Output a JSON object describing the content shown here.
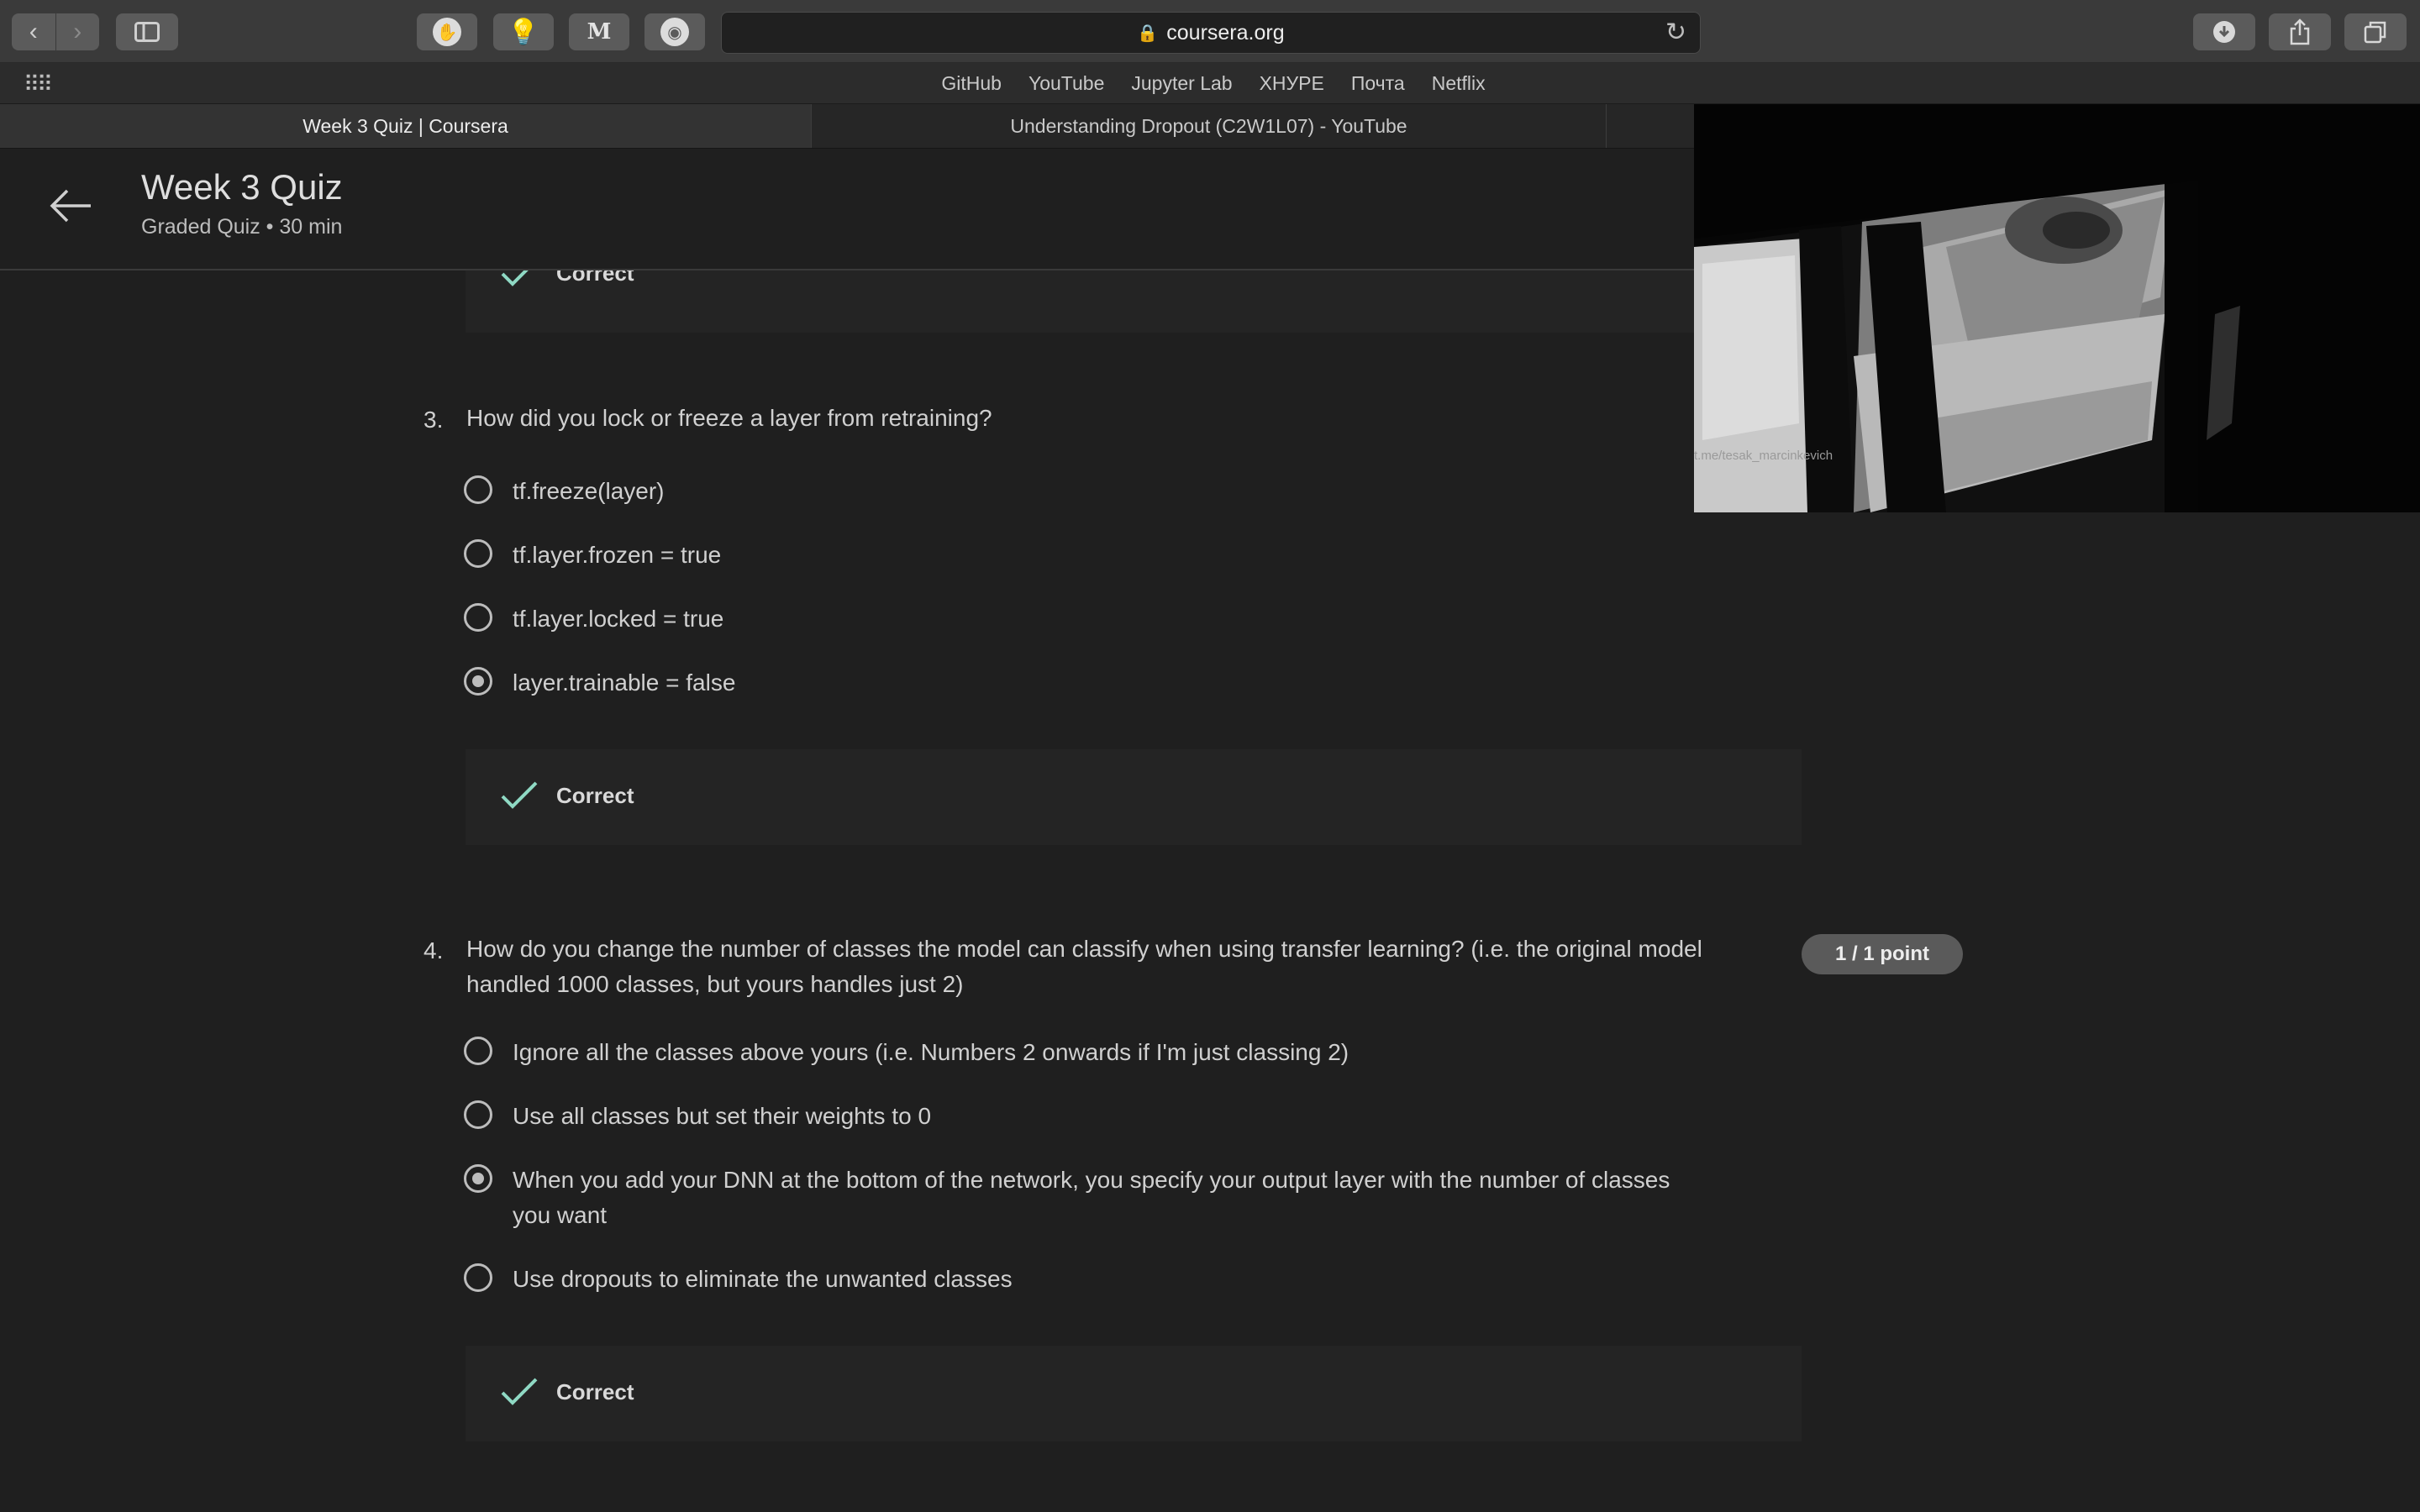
{
  "browser": {
    "url": "coursera.org",
    "favorites": [
      "GitHub",
      "YouTube",
      "Jupyter Lab",
      "ХНУРЕ",
      "Почта",
      "Netflix"
    ],
    "tabs": [
      {
        "label": "Week 3 Quiz | Coursera",
        "active": true
      },
      {
        "label": "Understanding Dropout (C2W1L07) - YouTube",
        "active": false
      }
    ]
  },
  "header": {
    "title": "Week 3 Quiz",
    "subtitle": "Graded Quiz • 30 min"
  },
  "previous_feedback": {
    "label": "Correct"
  },
  "questions": [
    {
      "number": "3.",
      "text": "How did you lock or freeze a layer from retraining?",
      "options": [
        {
          "label": "tf.freeze(layer)",
          "selected": false
        },
        {
          "label": "tf.layer.frozen = true",
          "selected": false
        },
        {
          "label": "tf.layer.locked = true",
          "selected": false
        },
        {
          "label": "layer.trainable = false",
          "selected": true
        }
      ],
      "feedback": "Correct"
    },
    {
      "number": "4.",
      "text_line1": "How do you change the number of classes the model can classify when using transfer learning? (i.e. the original model",
      "text_line2": "handled 1000 classes, but yours handles just 2)",
      "points": "1 / 1 point",
      "options": [
        {
          "label": "Ignore all the classes above yours (i.e. Numbers 2 onwards if I'm just classing 2)",
          "selected": false
        },
        {
          "label": "Use all classes but set their weights to 0",
          "selected": false
        },
        {
          "label_line1": "When you add your DNN at the bottom of the network, you specify your output layer with the number of classes",
          "label_line2": "you want",
          "selected": true
        },
        {
          "label": "Use dropouts to eliminate the unwanted classes",
          "selected": false
        }
      ],
      "feedback": "Correct"
    }
  ],
  "pip": {
    "watermark": "t.me/tesak_marcinkevich"
  },
  "colors": {
    "background": "#1f1f1f",
    "check": "#8fd9c4",
    "badge": "#5a5a5a"
  }
}
